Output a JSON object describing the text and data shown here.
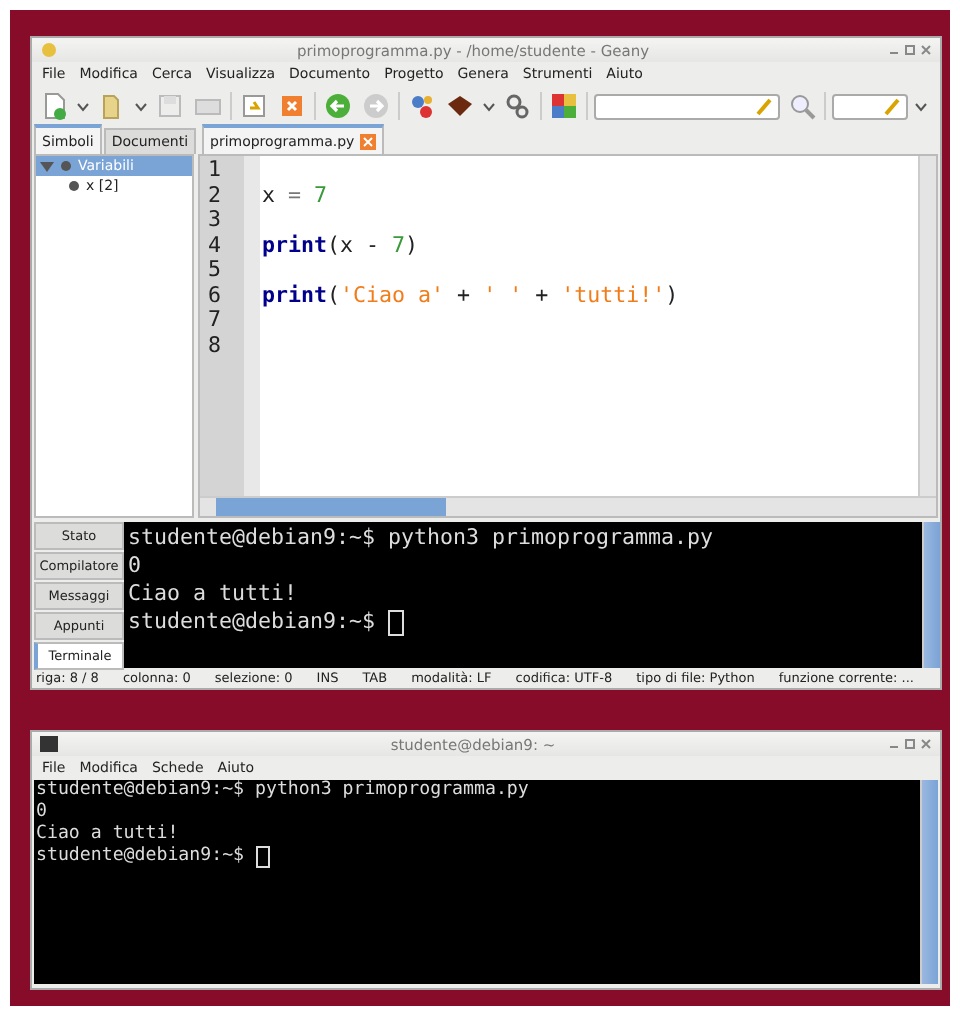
{
  "geany": {
    "title": "primoprogramma.py - /home/studente - Geany",
    "menu": [
      "File",
      "Modifica",
      "Cerca",
      "Visualizza",
      "Documento",
      "Progetto",
      "Genera",
      "Strumenti",
      "Aiuto"
    ],
    "sidebar": {
      "tabs": [
        {
          "label": "Simboli",
          "selected": true
        },
        {
          "label": "Documenti",
          "selected": false
        }
      ],
      "tree": [
        {
          "label": "Variabili",
          "expanded": true,
          "selected": true,
          "children": [
            {
              "label": "x [2]",
              "selected": false
            }
          ]
        }
      ]
    },
    "editor": {
      "tabs": [
        {
          "label": "primoprogramma.py",
          "selected": true
        }
      ],
      "lines": [
        {
          "number": "1"
        },
        {
          "number": "2",
          "tokens": [
            {
              "text": "x",
              "kind": "ident"
            },
            {
              "text": " = ",
              "kind": "op"
            },
            {
              "text": "7",
              "kind": "number"
            }
          ]
        },
        {
          "number": "3"
        },
        {
          "number": "4",
          "tokens": [
            {
              "text": "print",
              "kind": "keyword"
            },
            {
              "text": "(x - ",
              "kind": "ident"
            },
            {
              "text": "7",
              "kind": "number"
            },
            {
              "text": ")",
              "kind": "ident"
            }
          ]
        },
        {
          "number": "5"
        },
        {
          "number": "6",
          "tokens": [
            {
              "text": "print",
              "kind": "keyword"
            },
            {
              "text": "(",
              "kind": "ident"
            },
            {
              "text": "'Ciao a'",
              "kind": "string"
            },
            {
              "text": " + ",
              "kind": "ident"
            },
            {
              "text": "' '",
              "kind": "string"
            },
            {
              "text": " + ",
              "kind": "ident"
            },
            {
              "text": "'tutti!'",
              "kind": "string"
            },
            {
              "text": ")",
              "kind": "ident"
            }
          ]
        },
        {
          "number": "7"
        },
        {
          "number": "8"
        }
      ]
    },
    "message_tabs": [
      {
        "label": "Stato",
        "selected": false
      },
      {
        "label": "Compilatore",
        "selected": false
      },
      {
        "label": "Messaggi",
        "selected": false
      },
      {
        "label": "Appunti",
        "selected": false
      },
      {
        "label": "Terminale",
        "selected": true
      }
    ],
    "terminal": {
      "lines": [
        "studente@debian9:~$ python3 primoprogramma.py",
        "0",
        "Ciao a tutti!",
        "studente@debian9:~$ "
      ],
      "cursor": true
    },
    "status_bar": [
      "riga: 8 / 8",
      "colonna: 0",
      "selezione: 0",
      "INS",
      "TAB",
      "modalità: LF",
      "codifica: UTF-8",
      "tipo di file: Python",
      "funzione corrente: ..."
    ]
  },
  "terminal_window": {
    "title": "studente@debian9: ~",
    "menu": [
      "File",
      "Modifica",
      "Schede",
      "Aiuto"
    ],
    "lines": [
      "studente@debian9:~$ python3 primoprogramma.py",
      "0",
      "Ciao a tutti!",
      "studente@debian9:~$ "
    ],
    "cursor": true
  }
}
